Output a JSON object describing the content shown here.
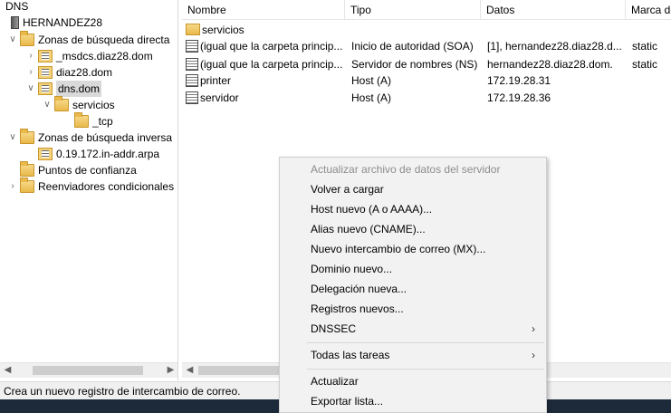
{
  "tree": {
    "root": "DNS",
    "server": "HERNANDEZ28",
    "items": [
      {
        "label": "Zonas de búsqueda directa"
      },
      {
        "label": "_msdcs.diaz28.dom"
      },
      {
        "label": "diaz28.dom"
      },
      {
        "label": "dns.dom"
      },
      {
        "label": "servicios"
      },
      {
        "label": "_tcp"
      },
      {
        "label": "Zonas de búsqueda inversa"
      },
      {
        "label": "0.19.172.in-addr.arpa"
      },
      {
        "label": "Puntos de confianza"
      },
      {
        "label": "Reenviadores condicionales"
      }
    ]
  },
  "list": {
    "columns": [
      "Nombre",
      "Tipo",
      "Datos",
      "Marca de"
    ],
    "rows": [
      {
        "name": "servicios",
        "type": "",
        "data": "",
        "stamp": ""
      },
      {
        "name": "(igual que la carpeta princip...",
        "type": "Inicio de autoridad (SOA)",
        "data": "[1], hernandez28.diaz28.d...",
        "stamp": "static"
      },
      {
        "name": "(igual que la carpeta princip...",
        "type": "Servidor de nombres (NS)",
        "data": "hernandez28.diaz28.dom.",
        "stamp": "static"
      },
      {
        "name": "printer",
        "type": "Host (A)",
        "data": "172.19.28.31",
        "stamp": ""
      },
      {
        "name": "servidor",
        "type": "Host (A)",
        "data": "172.19.28.36",
        "stamp": ""
      }
    ]
  },
  "status": {
    "text": "Crea un nuevo registro de intercambio de correo."
  },
  "menu": {
    "items": [
      "Actualizar archivo de datos del servidor",
      "Volver a cargar",
      "Host nuevo (A o AAAA)...",
      "Alias nuevo (CNAME)...",
      "Nuevo intercambio de correo (MX)...",
      "Dominio nuevo...",
      "Delegación nueva...",
      "Registros nuevos...",
      "DNSSEC",
      "Todas las tareas",
      "Actualizar",
      "Exportar lista..."
    ]
  },
  "colors": {
    "selection": "#d9d9d9",
    "menu_bg": "#f2f2f2",
    "disabled": "#8d8d8d"
  }
}
